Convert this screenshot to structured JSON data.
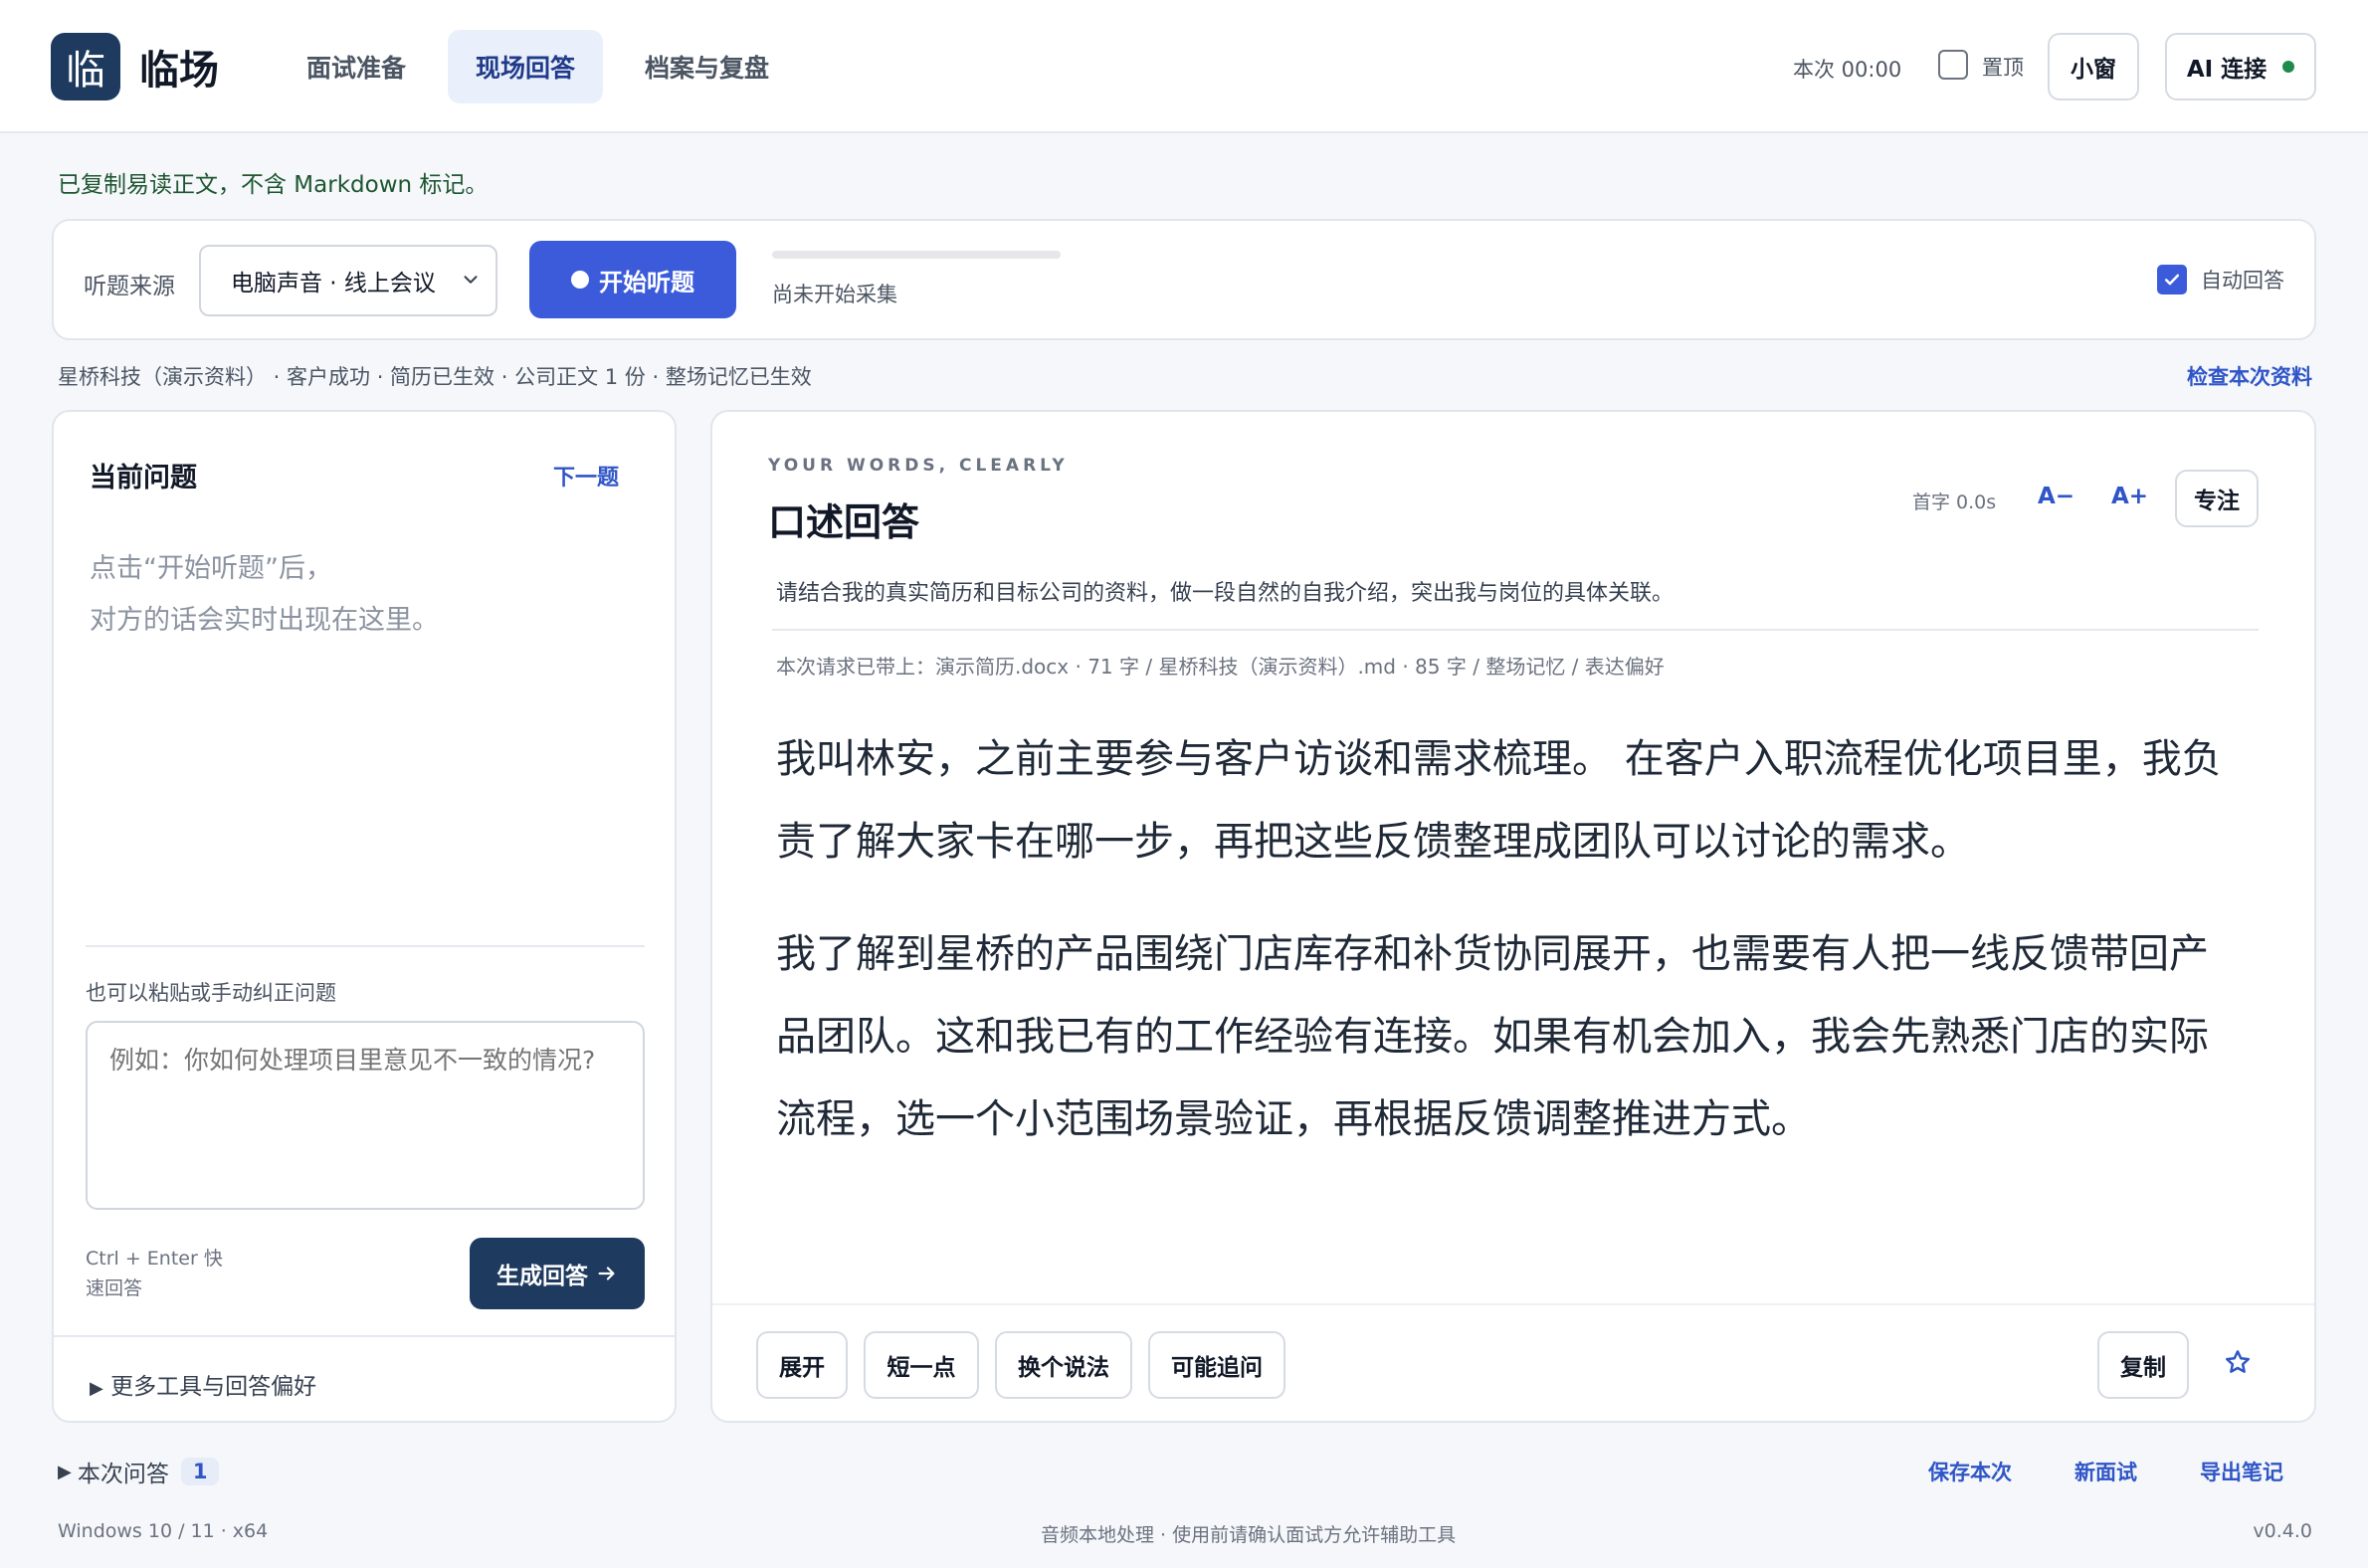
{
  "header": {
    "logo_glyph": "临",
    "app_name": "临场",
    "tabs": [
      {
        "label": "面试准备",
        "active": false
      },
      {
        "label": "现场回答",
        "active": true
      },
      {
        "label": "档案与复盘",
        "active": false
      }
    ],
    "timer": "本次 00:00",
    "pin_label": "置顶",
    "pin_checked": false,
    "mini_window_label": "小窗",
    "ai_label": "AI 连接",
    "ai_status_color": "#1f8a4c"
  },
  "notice": "已复制易读正文，不含 Markdown 标记。",
  "listen": {
    "source_label": "听题来源",
    "source_value": "电脑声音 · 线上会议",
    "start_label": "开始听题",
    "progress": 0,
    "status": "尚未开始采集",
    "auto_answer_label": "自动回答",
    "auto_answer_checked": true
  },
  "meta": {
    "line": "星桥科技（演示资料） · 客户成功 · 简历已生效 · 公司正文 1 份 · 整场记忆已生效",
    "check_link": "检查本次资料"
  },
  "question_panel": {
    "title": "当前问题",
    "next_label": "下一题",
    "hint_lines": [
      "点击“开始听题”后，",
      "对方的话会实时出现在这里。"
    ],
    "paste_label": "也可以粘贴或手动纠正问题",
    "textarea_placeholder": "例如：你如何处理项目里意见不一致的情况?",
    "shortcut_lines": [
      "Ctrl + Enter 快",
      "速回答"
    ],
    "generate_label": "生成回答",
    "more_tools": "更多工具与回答偏好"
  },
  "answer_panel": {
    "eyebrow": "YOUR WORDS, CLEARLY",
    "title": "口述回答",
    "first_char_time": "首字 0.0s",
    "font_decrease": "A−",
    "font_increase": "A+",
    "focus_label": "专注",
    "prompt": "请结合我的真实简历和目标公司的资料，做一段自然的自我介绍，突出我与岗位的具体关联。",
    "attachments": "本次请求已带上：演示简历.docx · 71 字 / 星桥科技（演示资料）.md · 85 字 / 整场记忆 / 表达偏好",
    "paragraphs": [
      "我叫林安，之前主要参与客户访谈和需求梳理。 在客户入职流程优化项目里，我负责了解大家卡在哪一步，再把这些反馈整理成团队可以讨论的需求。",
      "我了解到星桥的产品围绕门店库存和补货协同展开，也需要有人把一线反馈带回产品团队。这和我已有的工作经验有连接。如果有机会加入，我会先熟悉门店的实际流程，选一个小范围场景验证，再根据反馈调整推进方式。"
    ],
    "actions": [
      "展开",
      "短一点",
      "换个说法",
      "可能追问"
    ],
    "copy_label": "复制"
  },
  "footer": {
    "history_label": "本次问答",
    "history_count": "1",
    "links": [
      "保存本次",
      "新面试",
      "导出笔记"
    ],
    "platform": "Windows 10 / 11 · x64",
    "privacy": "音频本地处理 · 使用前请确认面试方允许辅助工具",
    "version": "v0.4.0"
  },
  "colors": {
    "brand": "#1e3a5f",
    "accent": "#3b5bdb",
    "link": "#2f55c7",
    "success_text": "#1e5631"
  }
}
